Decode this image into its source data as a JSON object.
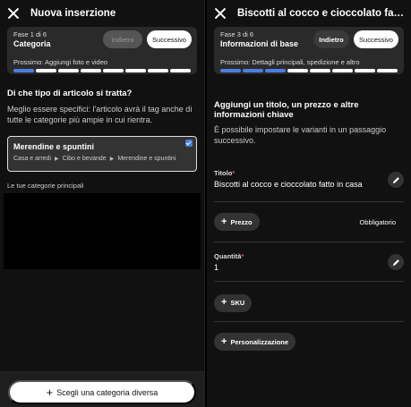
{
  "left": {
    "title": "Nuova inserzione",
    "step_num": "Fase 1 di 6",
    "step_name": "Categoria",
    "back_label": "Indietro",
    "next_label": "Successivo",
    "next_step": "Prossimo: Aggiungi foto e video",
    "progress_done": 1,
    "progress_total": 8,
    "question": "Di che tipo di articolo si tratta?",
    "question_desc": "Meglio essere specifici: l'articolo avrà il tag anche di tutte le categorie più ampie in cui rientra.",
    "selected_category": {
      "name": "Merendine e spuntini",
      "path": [
        "Casa e arredi",
        "Cibo e bevande",
        "Merendine e spuntini"
      ]
    },
    "categories_label": "Le tue categorie principali",
    "bottom_button": "Scegli una categoria diversa"
  },
  "right": {
    "title": "Biscotti al cocco e cioccolato fatto in ...",
    "step_num": "Fase 3 di 6",
    "step_name": "Informazioni di base",
    "back_label": "Indietro",
    "next_label": "Successivo",
    "next_step": "Prossimo: Dettagli principali, spedizione e altro",
    "progress_done": 3,
    "progress_total": 8,
    "section_title": "Aggiungi un titolo, un prezzo e altre informazioni chiave",
    "section_desc": "È possibile impostare le varianti in un passaggio successivo.",
    "title_label": "Titolo",
    "title_value": "Biscotti al cocco e cioccolato fatto in casa",
    "price_label": "Prezzo",
    "price_required": "Obbligatorio",
    "quantity_label": "Quantità",
    "quantity_value": "1",
    "sku_label": "SKU",
    "personalization_label": "Personalizzazione"
  },
  "icons": {
    "close": "close-icon",
    "check": "check-icon",
    "plus": "plus-icon",
    "edit": "pencil-icon",
    "chevron": "chevron-right-icon"
  },
  "colors": {
    "accent": "#4a7fe0",
    "background": "#111111",
    "required": "#e55555"
  }
}
